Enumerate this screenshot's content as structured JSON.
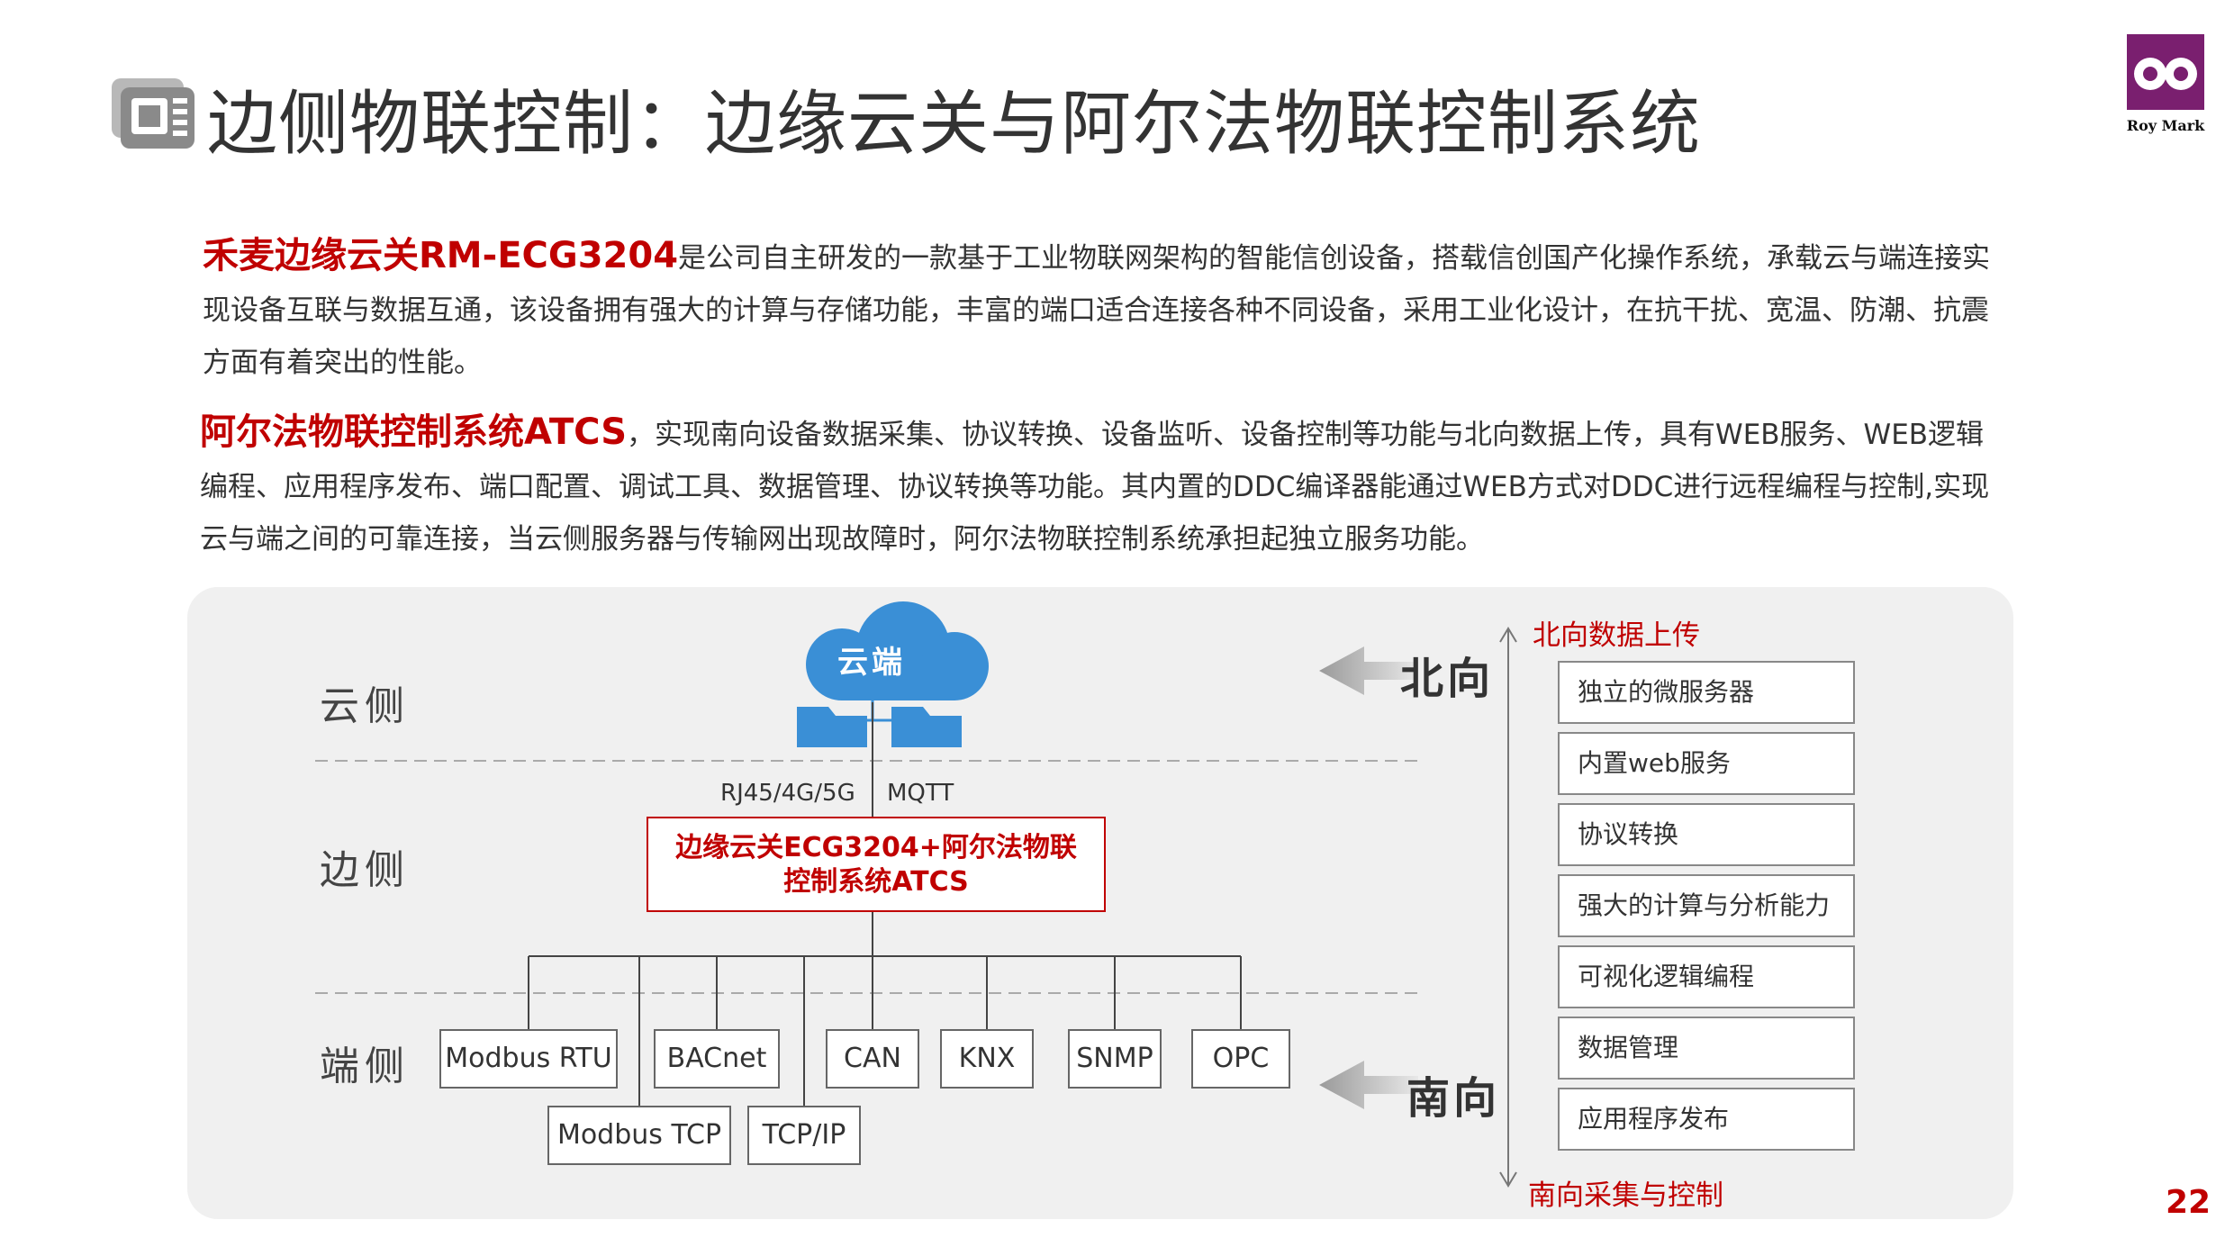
{
  "header": {
    "title": "边侧物联控制：边缘云关与阿尔法物联控制系统",
    "logo_text": "Roy Mark"
  },
  "intro": {
    "p1_highlight": "禾麦边缘云关RM-ECG3204",
    "p1_text": "是公司自主研发的一款基于工业物联网架构的智能信创设备，搭载信创国产化操作系统，承载云与端连接实现设备互联与数据互通，该设备拥有强大的计算与存储功能，丰富的端口适合连接各种不同设备，采用工业化设计，在抗干扰、宽温、防潮、抗震方面有着突出的性能。",
    "p2_highlight": "阿尔法物联控制系统ATCS",
    "p2_text": "，实现南向设备数据采集、协议转换、设备监听、设备控制等功能与北向数据上传，具有WEB服务、WEB逻辑编程、应用程序发布、端口配置、调试工具、数据管理、协议转换等功能。其内置的DDC编译器能通过WEB方式对DDC进行远程编程与控制,实现云与端之间的可靠连接，当云侧服务器与传输网出现故障时，阿尔法物联控制系统承担起独立服务功能。"
  },
  "diagram": {
    "layers": {
      "cloud": "云侧",
      "edge": "边侧",
      "device": "端侧"
    },
    "cloud_label": "云端",
    "connection": {
      "physical": "RJ45/4G/5G",
      "protocol": "MQTT"
    },
    "gateway": {
      "line1": "边缘云关ECG3204+阿尔法物联",
      "line2": "控制系统ATCS"
    },
    "protocols_row1": [
      "Modbus RTU",
      "BACnet",
      "CAN",
      "KNX",
      "SNMP",
      "OPC"
    ],
    "protocols_row2": [
      "Modbus TCP",
      "TCP/IP"
    ],
    "north": {
      "label": "北向",
      "caption": "北向数据上传"
    },
    "south": {
      "label": "南向",
      "caption": "南向采集与控制"
    },
    "features": [
      "独立的微服务器",
      "内置web服务",
      "协议转换",
      "强大的计算与分析能力",
      "可视化逻辑编程",
      "数据管理",
      "应用程序发布"
    ]
  },
  "page_number": "22",
  "colors": {
    "accent_red": "#c00000",
    "cloud_blue": "#3a8fd6",
    "panel_bg": "#f0f0f0"
  }
}
